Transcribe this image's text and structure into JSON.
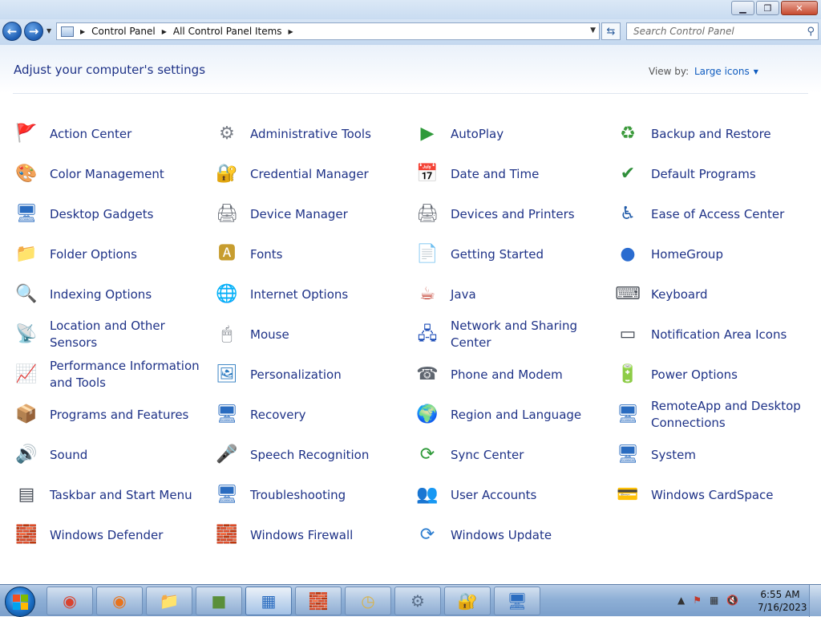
{
  "window": {
    "minimize_icon": "minimize-icon",
    "maximize_icon": "restore-icon",
    "close_icon": "close-icon"
  },
  "address_bar": {
    "breadcrumb": [
      "Control Panel",
      "All Control Panel Items"
    ],
    "search_placeholder": "Search Control Panel"
  },
  "header": {
    "title": "Adjust your computer's settings",
    "view_by_label": "View by:",
    "view_by_value": "Large icons"
  },
  "items": [
    {
      "label": "Action Center",
      "icon": "🚩",
      "color": "#1f4fb8"
    },
    {
      "label": "Administrative Tools",
      "icon": "⚙",
      "color": "#7a7f88"
    },
    {
      "label": "AutoPlay",
      "icon": "▶",
      "color": "#2f9a3a"
    },
    {
      "label": "Backup and Restore",
      "icon": "♻",
      "color": "#3c9a3c"
    },
    {
      "label": "Color Management",
      "icon": "🎨",
      "color": "#3b6fd0"
    },
    {
      "label": "Credential Manager",
      "icon": "🔐",
      "color": "#b8912a"
    },
    {
      "label": "Date and Time",
      "icon": "📅",
      "color": "#3b78c9"
    },
    {
      "label": "Default Programs",
      "icon": "✔",
      "color": "#2f8f3a"
    },
    {
      "label": "Desktop Gadgets",
      "icon": "🖥",
      "color": "#2a6cc0"
    },
    {
      "label": "Device Manager",
      "icon": "🖨",
      "color": "#6a6f78"
    },
    {
      "label": "Devices and Printers",
      "icon": "🖨",
      "color": "#6a6f78"
    },
    {
      "label": "Ease of Access Center",
      "icon": "♿",
      "color": "#1f5aa8"
    },
    {
      "label": "Folder Options",
      "icon": "📁",
      "color": "#d8b24a"
    },
    {
      "label": "Fonts",
      "icon": "🅰",
      "color": "#c79d2f"
    },
    {
      "label": "Getting Started",
      "icon": "📄",
      "color": "#3f8fc4"
    },
    {
      "label": "HomeGroup",
      "icon": "●",
      "color": "#2a6cd0"
    },
    {
      "label": "Indexing Options",
      "icon": "🔍",
      "color": "#6b7b8f"
    },
    {
      "label": "Internet Options",
      "icon": "🌐",
      "color": "#2f7fd0"
    },
    {
      "label": "Java",
      "icon": "☕",
      "color": "#c0392b"
    },
    {
      "label": "Keyboard",
      "icon": "⌨",
      "color": "#555a62"
    },
    {
      "label": "Location and Other Sensors",
      "icon": "📡",
      "color": "#5b8f3a"
    },
    {
      "label": "Mouse",
      "icon": "🖱",
      "color": "#6a6f78"
    },
    {
      "label": "Network and Sharing Center",
      "icon": "🖧",
      "color": "#1f4fb8"
    },
    {
      "label": "Notification Area Icons",
      "icon": "▭",
      "color": "#444b55"
    },
    {
      "label": "Performance Information and Tools",
      "icon": "📈",
      "color": "#2d8a3a"
    },
    {
      "label": "Personalization",
      "icon": "🖼",
      "color": "#2a7ac0"
    },
    {
      "label": "Phone and Modem",
      "icon": "☎",
      "color": "#5f6670"
    },
    {
      "label": "Power Options",
      "icon": "🔋",
      "color": "#3a9a3a"
    },
    {
      "label": "Programs and Features",
      "icon": "📦",
      "color": "#6a6f78"
    },
    {
      "label": "Recovery",
      "icon": "🖥",
      "color": "#2a6cc0"
    },
    {
      "label": "Region and Language",
      "icon": "🌍",
      "color": "#2f7fd0"
    },
    {
      "label": "RemoteApp and Desktop Connections",
      "icon": "🖥",
      "color": "#2a6cc0"
    },
    {
      "label": "Sound",
      "icon": "🔊",
      "color": "#8a8f98"
    },
    {
      "label": "Speech Recognition",
      "icon": "🎤",
      "color": "#6a6f78"
    },
    {
      "label": "Sync Center",
      "icon": "⟳",
      "color": "#2f9a3a"
    },
    {
      "label": "System",
      "icon": "🖥",
      "color": "#2a6cc0"
    },
    {
      "label": "Taskbar and Start Menu",
      "icon": "▤",
      "color": "#444b55"
    },
    {
      "label": "Troubleshooting",
      "icon": "🖥",
      "color": "#2a6cc0"
    },
    {
      "label": "User Accounts",
      "icon": "👥",
      "color": "#6a7f4a"
    },
    {
      "label": "Windows CardSpace",
      "icon": "💳",
      "color": "#5a6fc0"
    },
    {
      "label": "Windows Defender",
      "icon": "🧱",
      "color": "#7a7f88"
    },
    {
      "label": "Windows Firewall",
      "icon": "🧱",
      "color": "#a0452a"
    },
    {
      "label": "Windows Update",
      "icon": "⟳",
      "color": "#2f7fd0"
    }
  ],
  "taskbar": {
    "start_icon": "windows-start-icon",
    "buttons": [
      {
        "name": "chrome",
        "icon": "◉",
        "color": "#d9432f",
        "active": false
      },
      {
        "name": "firefox",
        "icon": "◉",
        "color": "#e8731c",
        "active": false
      },
      {
        "name": "file-explorer",
        "icon": "📁",
        "color": "#d8b24a",
        "active": false
      },
      {
        "name": "minecraft",
        "icon": "■",
        "color": "#5a8f3a",
        "active": false
      },
      {
        "name": "control-panel",
        "icon": "▦",
        "color": "#2a6cc0",
        "active": true
      },
      {
        "name": "windows-firewall",
        "icon": "🧱",
        "color": "#a0452a",
        "active": false
      },
      {
        "name": "clock",
        "icon": "◷",
        "color": "#d8b24a",
        "active": false
      },
      {
        "name": "settings",
        "icon": "⚙",
        "color": "#5a6f8a",
        "active": false
      },
      {
        "name": "credential-manager",
        "icon": "🔐",
        "color": "#b8912a",
        "active": false
      },
      {
        "name": "remote-desktop",
        "icon": "🖥",
        "color": "#2a6cc0",
        "active": false
      }
    ],
    "clock_time": "6:55 AM",
    "clock_date": "7/16/2023"
  }
}
